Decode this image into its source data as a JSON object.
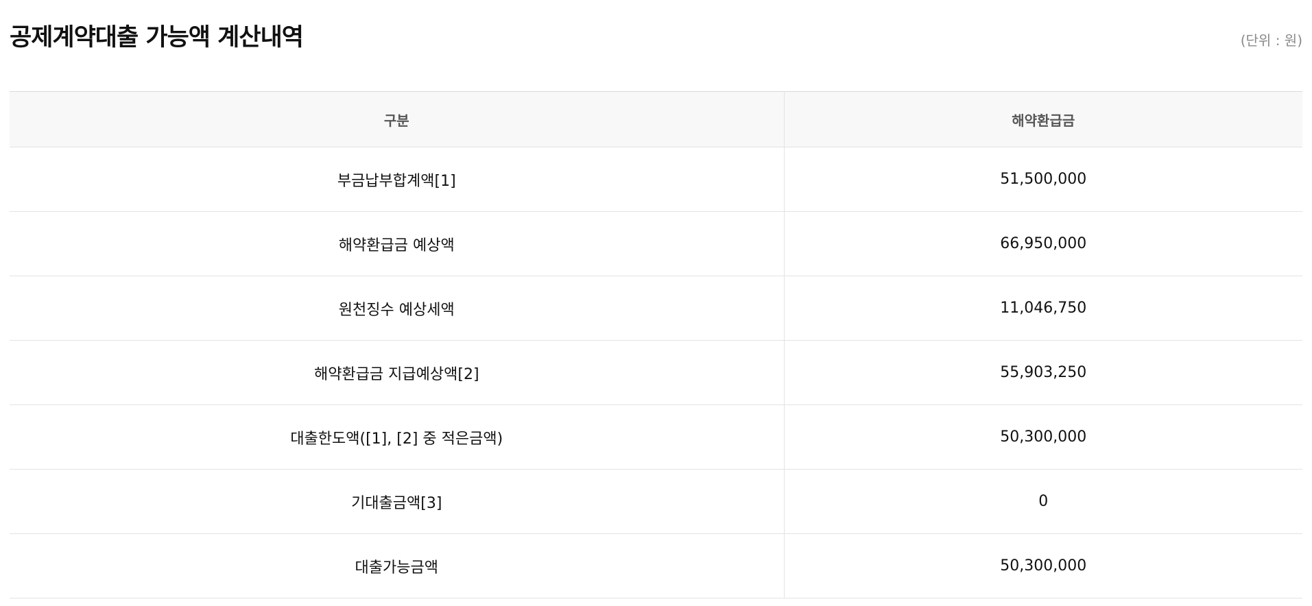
{
  "title": "공제계약대출 가능액 계산내역",
  "unit": "(단위 : 원)",
  "table": {
    "headers": [
      "구분",
      "해약환급금"
    ],
    "rows": [
      {
        "label": "부금납부합계액[1]",
        "value": "51,500,000"
      },
      {
        "label": "해약환급금 예상액",
        "value": "66,950,000"
      },
      {
        "label": "원천징수 예상세액",
        "value": "11,046,750"
      },
      {
        "label": "해약환급금 지급예상액[2]",
        "value": "55,903,250"
      },
      {
        "label": "대출한도액([1], [2] 중 적은금액)",
        "value": "50,300,000"
      },
      {
        "label": "기대출금액[3]",
        "value": "0"
      },
      {
        "label": "대출가능금액",
        "value": "50,300,000"
      }
    ]
  }
}
